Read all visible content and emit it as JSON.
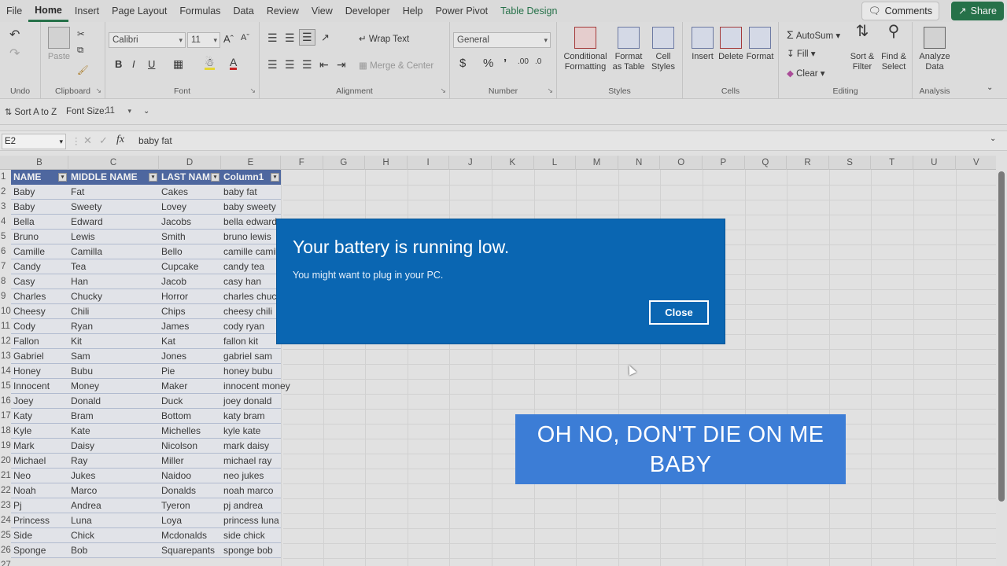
{
  "menubar": {
    "items": [
      "File",
      "Home",
      "Insert",
      "Page Layout",
      "Formulas",
      "Data",
      "Review",
      "View",
      "Developer",
      "Help",
      "Power Pivot",
      "Table Design"
    ],
    "active": "Home",
    "comments_label": "Comments",
    "share_label": "Share"
  },
  "ribbon": {
    "undo_group": "Undo",
    "clipboard_group": "Clipboard",
    "paste_label": "Paste",
    "font_group": "Font",
    "font_name": "Calibri",
    "font_size": "11",
    "alignment_group": "Alignment",
    "wrap_text": "Wrap Text",
    "merge_center": "Merge & Center",
    "number_group": "Number",
    "number_format": "General",
    "styles_group": "Styles",
    "conditional_formatting": "Conditional Formatting",
    "format_as_table": "Format as Table",
    "cell_styles": "Cell Styles",
    "cells_group": "Cells",
    "insert": "Insert",
    "delete": "Delete",
    "format": "Format",
    "editing_group": "Editing",
    "autosum": "AutoSum",
    "fill": "Fill",
    "clear": "Clear",
    "sort_filter": "Sort & Filter",
    "find_select": "Find & Select",
    "analysis_group": "Analysis",
    "analyze_data": "Analyze Data"
  },
  "qat": {
    "sort_label": "Sort A to Z",
    "font_size_label": "Font Size:",
    "font_size_value": "11"
  },
  "formula_bar": {
    "name_box": "E2",
    "value": "baby fat"
  },
  "columns": [
    "B",
    "C",
    "D",
    "E",
    "F",
    "G",
    "H",
    "I",
    "J",
    "K",
    "L",
    "M",
    "N",
    "O",
    "P",
    "Q",
    "R",
    "S",
    "T",
    "U",
    "V"
  ],
  "table": {
    "headers": [
      "NAME",
      "MIDDLE NAME",
      "LAST NAME",
      "Column1"
    ],
    "rows": [
      [
        "Baby",
        "Fat",
        "Cakes",
        "baby fat"
      ],
      [
        "Baby",
        "Sweety",
        "Lovey",
        "baby sweety"
      ],
      [
        "Bella",
        "Edward",
        "Jacobs",
        "bella edward"
      ],
      [
        "Bruno",
        "Lewis",
        "Smith",
        "bruno lewis"
      ],
      [
        "Camille",
        "Camilla",
        "Bello",
        "camille camill"
      ],
      [
        "Candy",
        "Tea",
        "Cupcake",
        "candy tea"
      ],
      [
        "Casy",
        "Han",
        "Jacob",
        "casy han"
      ],
      [
        "Charles",
        "Chucky",
        "Horror",
        "charles chucky"
      ],
      [
        "Cheesy",
        "Chili",
        "Chips",
        "cheesy chili"
      ],
      [
        "Cody",
        "Ryan",
        "James",
        "cody ryan"
      ],
      [
        "Fallon",
        "Kit",
        "Kat",
        "fallon kit"
      ],
      [
        "Gabriel",
        "Sam",
        "Jones",
        "gabriel sam"
      ],
      [
        "Honey",
        "Bubu",
        "Pie",
        "honey bubu"
      ],
      [
        "Innocent",
        "Money",
        "Maker",
        "innocent money"
      ],
      [
        "Joey",
        "Donald",
        "Duck",
        "joey donald"
      ],
      [
        "Katy",
        "Bram",
        "Bottom",
        "katy bram"
      ],
      [
        "Kyle",
        "Kate",
        "Michelles",
        "kyle kate"
      ],
      [
        "Mark",
        "Daisy",
        "Nicolson",
        "mark daisy"
      ],
      [
        "Michael",
        "Ray",
        "Miller",
        "michael ray"
      ],
      [
        "Neo",
        "Jukes",
        "Naidoo",
        "neo jukes"
      ],
      [
        "Noah",
        "Marco",
        "Donalds",
        "noah marco"
      ],
      [
        "Pj",
        "Andrea",
        "Tyeron",
        "pj andrea"
      ],
      [
        "Princess",
        "Luna",
        "Loya",
        "princess luna"
      ],
      [
        "Side",
        "Chick",
        "Mcdonalds",
        "side chick"
      ],
      [
        "Sponge",
        "Bob",
        "Squarepants",
        "sponge bob"
      ]
    ]
  },
  "toast": {
    "title": "Your battery is running low.",
    "message": "You might want to plug in your PC.",
    "close_label": "Close"
  },
  "caption": "OH NO, DON'T DIE ON ME BABY",
  "colors": {
    "toast_bg": "#0a66b2",
    "caption_bg": "#3c7dd6",
    "table_header": "#4a66a4",
    "excel_green": "#1e7145"
  }
}
